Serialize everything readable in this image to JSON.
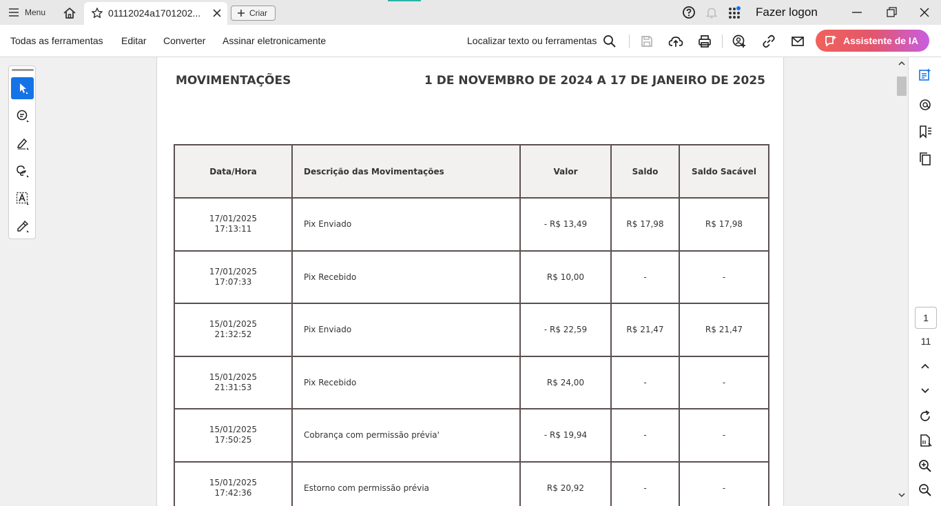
{
  "titlebar": {
    "menu_label": "Menu",
    "tab_label": "01112024a1701202...",
    "create_label": "Criar",
    "login_label": "Fazer logon",
    "notification_color": "#1473e6"
  },
  "toolbar": {
    "menus": [
      "Todas as ferramentas",
      "Editar",
      "Converter",
      "Assinar eletronicamente"
    ],
    "search_label": "Localizar texto ou ferramentas",
    "ai_label": "Assistente de IA"
  },
  "document": {
    "title": "MOVIMENTAÇÕES",
    "period": "1 DE NOVEMBRO DE 2024 A 17 DE JANEIRO DE 2025",
    "headers": [
      "Data/Hora",
      "Descrição das Movimentações",
      "Valor",
      "Saldo",
      "Saldo Sacável"
    ],
    "rows": [
      {
        "date": "17/01/2025",
        "time": "17:13:11",
        "desc": "Pix Enviado",
        "value": "- R$ 13,49",
        "balance": "R$ 17,98",
        "withdrawable": "R$ 17,98"
      },
      {
        "date": "17/01/2025",
        "time": "17:07:33",
        "desc": "Pix Recebido",
        "value": "R$ 10,00",
        "balance": "-",
        "withdrawable": "-"
      },
      {
        "date": "15/01/2025",
        "time": "21:32:52",
        "desc": "Pix Enviado",
        "value": "- R$ 22,59",
        "balance": "R$ 21,47",
        "withdrawable": "R$ 21,47"
      },
      {
        "date": "15/01/2025",
        "time": "21:31:53",
        "desc": "Pix Recebido",
        "value": "R$ 24,00",
        "balance": "-",
        "withdrawable": "-"
      },
      {
        "date": "15/01/2025",
        "time": "17:50:25",
        "desc": "Cobrança com permissão prévia'",
        "value": "- R$ 19,94",
        "balance": "-",
        "withdrawable": "-"
      },
      {
        "date": "15/01/2025",
        "time": "17:42:36",
        "desc": "Estorno com permissão prévia",
        "value": "R$ 20,92",
        "balance": "-",
        "withdrawable": "-"
      }
    ]
  },
  "pager": {
    "current": "1",
    "total": "11"
  }
}
